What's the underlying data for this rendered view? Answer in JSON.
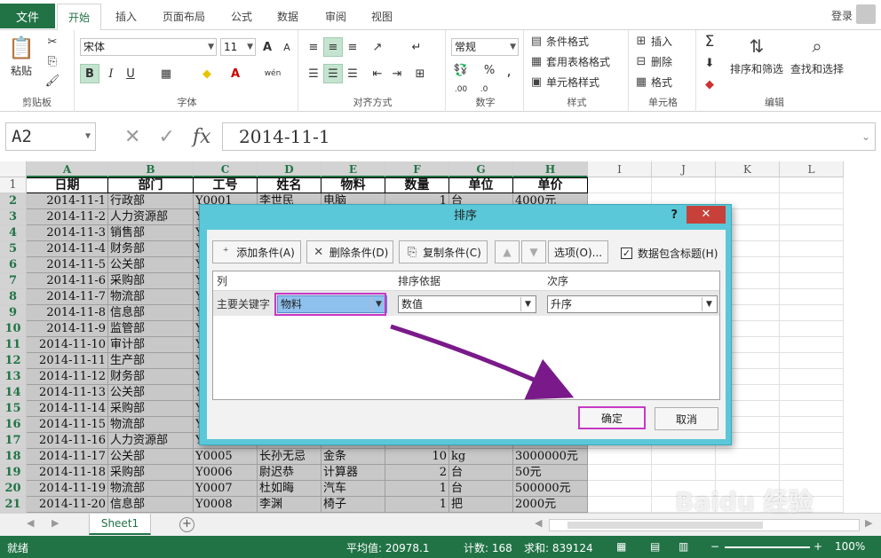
{
  "ribbon_tabs": [
    "文件",
    "开始",
    "插入",
    "页面布局",
    "公式",
    "数据",
    "审阅",
    "视图"
  ],
  "login": "登录",
  "clipboard": {
    "paste": "粘贴",
    "label": "剪贴板"
  },
  "font": {
    "name": "宋体",
    "size": "11",
    "label": "字体",
    "bold": "B",
    "italic": "I",
    "underline": "U",
    "grow": "A",
    "shrink": "A",
    "phonetic": "wén"
  },
  "alignment": {
    "label": "对齐方式"
  },
  "number": {
    "format": "常规",
    "label": "数字"
  },
  "styles": {
    "conditional": "条件格式",
    "table": "套用表格格式",
    "cell": "单元格样式",
    "label": "样式"
  },
  "cells": {
    "insert": "插入",
    "delete": "删除",
    "format": "格式",
    "label": "单元格"
  },
  "editing": {
    "sort": "排序和筛选",
    "find": "查找和选择",
    "label": "编辑"
  },
  "formula_bar": {
    "name_box": "A2",
    "content": "2014-11-1"
  },
  "columns": [
    "A",
    "B",
    "C",
    "D",
    "E",
    "F",
    "G",
    "H",
    "I",
    "J",
    "K",
    "L"
  ],
  "headers": [
    "日期",
    "部门",
    "工号",
    "姓名",
    "物料",
    "数量",
    "单位",
    "单价"
  ],
  "rows": [
    [
      "2014-11-1",
      "行政部",
      "Y0001",
      "李世民",
      "电脑",
      "1",
      "台",
      "4000元"
    ],
    [
      "2014-11-2",
      "人力资源部",
      "Y",
      "",
      "",
      "",
      "",
      ""
    ],
    [
      "2014-11-3",
      "销售部",
      "Y",
      "",
      "",
      "",
      "",
      ""
    ],
    [
      "2014-11-4",
      "财务部",
      "Y",
      "",
      "",
      "",
      "",
      ""
    ],
    [
      "2014-11-5",
      "公关部",
      "Y",
      "",
      "",
      "",
      "",
      ""
    ],
    [
      "2014-11-6",
      "采购部",
      "Y",
      "",
      "",
      "",
      "",
      ""
    ],
    [
      "2014-11-7",
      "物流部",
      "Y",
      "",
      "",
      "",
      "",
      ""
    ],
    [
      "2014-11-8",
      "信息部",
      "Y",
      "",
      "",
      "",
      "",
      ""
    ],
    [
      "2014-11-9",
      "监管部",
      "Y",
      "",
      "",
      "",
      "",
      ""
    ],
    [
      "2014-11-10",
      "审计部",
      "Y",
      "",
      "",
      "",
      "",
      ""
    ],
    [
      "2014-11-11",
      "生产部",
      "Y",
      "",
      "",
      "",
      "",
      ""
    ],
    [
      "2014-11-12",
      "财务部",
      "Y",
      "",
      "",
      "",
      "",
      ""
    ],
    [
      "2014-11-13",
      "公关部",
      "Y",
      "",
      "",
      "",
      "",
      ""
    ],
    [
      "2014-11-14",
      "采购部",
      "Y",
      "",
      "",
      "",
      "",
      ""
    ],
    [
      "2014-11-15",
      "物流部",
      "Y",
      "",
      "",
      "",
      "",
      ""
    ],
    [
      "2014-11-16",
      "人力资源部",
      "Y",
      "",
      "",
      "",
      "",
      ""
    ],
    [
      "2014-11-17",
      "公关部",
      "Y0005",
      "长孙无忌",
      "金条",
      "10",
      "kg",
      "3000000元"
    ],
    [
      "2014-11-18",
      "采购部",
      "Y0006",
      "尉迟恭",
      "计算器",
      "2",
      "台",
      "50元"
    ],
    [
      "2014-11-19",
      "物流部",
      "Y0007",
      "杜如晦",
      "汽车",
      "1",
      "台",
      "500000元"
    ],
    [
      "2014-11-20",
      "信息部",
      "Y0008",
      "李渊",
      "椅子",
      "1",
      "把",
      "2000元"
    ]
  ],
  "sheet_tab": "Sheet1",
  "status": {
    "ready": "就绪",
    "average": "平均值: 20978.1",
    "count": "计数: 168",
    "sum": "求和: 839124",
    "zoom": "100%"
  },
  "dialog": {
    "title": "排序",
    "help": "?",
    "close": "✕",
    "add": "添加条件(A)",
    "delete": "删除条件(D)",
    "copy": "复制条件(C)",
    "options": "选项(O)...",
    "has_header": "数据包含标题(H)",
    "col_header": "列",
    "basis_header": "排序依据",
    "order_header": "次序",
    "row_label": "主要关键字",
    "key": "物料",
    "basis": "数值",
    "order": "升序",
    "ok": "确定",
    "cancel": "取消"
  },
  "watermark": "Baidu 经验",
  "colors": {
    "accent": "#217346",
    "highlight": "#c638c6",
    "arrow": "#7a1a8a",
    "dialog_frame": "#5ac8d8"
  }
}
